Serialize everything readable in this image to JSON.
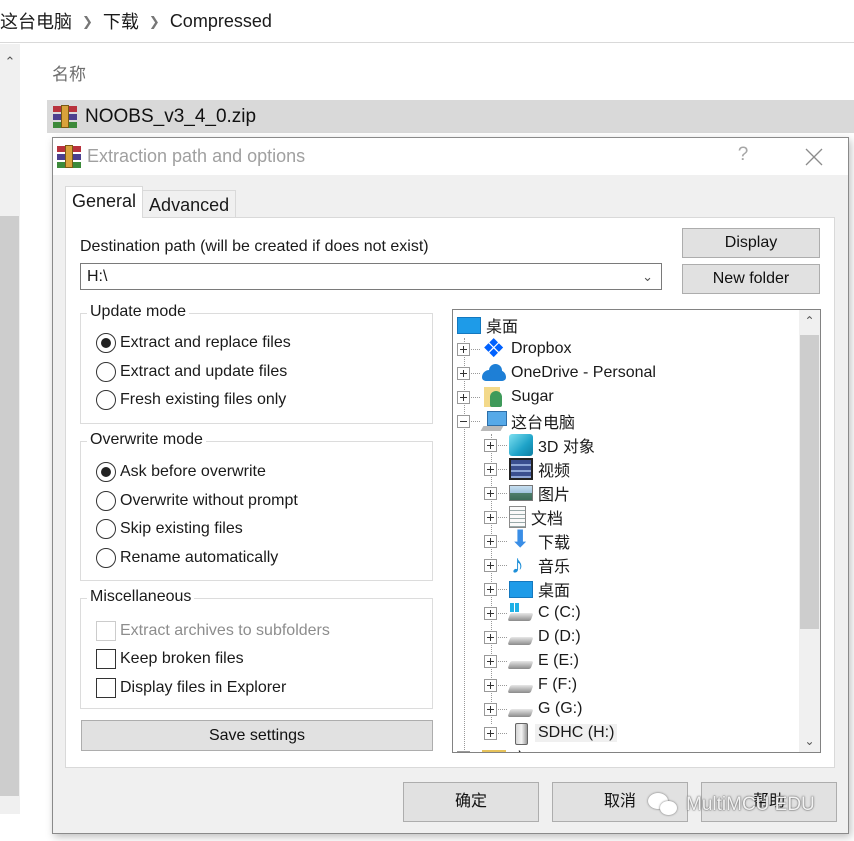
{
  "explorer": {
    "breadcrumb": [
      "这台电脑",
      "下载",
      "Compressed"
    ],
    "column_header": "名称",
    "selected_file": "NOOBS_v3_4_0.zip"
  },
  "dialog": {
    "title": "Extraction path and options",
    "help_glyph": "?",
    "tabs": [
      {
        "label": "General",
        "active": true
      },
      {
        "label": "Advanced",
        "active": false
      }
    ],
    "destination": {
      "label": "Destination path (will be created if does not exist)",
      "value": "H:\\"
    },
    "buttons": {
      "display": "Display",
      "new_folder": "New folder",
      "save_settings": "Save settings",
      "ok": "确定",
      "cancel": "取消",
      "help": "帮助"
    },
    "update_mode": {
      "title": "Update mode",
      "options": [
        {
          "label": "Extract and replace files",
          "selected": true
        },
        {
          "label": "Extract and update files",
          "selected": false
        },
        {
          "label": "Fresh existing files only",
          "selected": false
        }
      ]
    },
    "overwrite_mode": {
      "title": "Overwrite mode",
      "options": [
        {
          "label": "Ask before overwrite",
          "selected": true
        },
        {
          "label": "Overwrite without prompt",
          "selected": false
        },
        {
          "label": "Skip existing files",
          "selected": false
        },
        {
          "label": "Rename automatically",
          "selected": false
        }
      ]
    },
    "miscellaneous": {
      "title": "Miscellaneous",
      "options": [
        {
          "label": "Extract archives to subfolders",
          "checked": false,
          "disabled": true
        },
        {
          "label": "Keep broken files",
          "checked": false,
          "disabled": false
        },
        {
          "label": "Display files in Explorer",
          "checked": false,
          "disabled": false
        }
      ]
    },
    "tree": [
      {
        "label": "桌面",
        "icon": "desktop",
        "level": 0,
        "expander": "none"
      },
      {
        "label": "Dropbox",
        "icon": "dropbox",
        "level": 1,
        "expander": "plus"
      },
      {
        "label": "OneDrive - Personal",
        "icon": "onedrive",
        "level": 1,
        "expander": "plus"
      },
      {
        "label": "Sugar",
        "icon": "user-folder",
        "level": 1,
        "expander": "plus"
      },
      {
        "label": "这台电脑",
        "icon": "this-pc",
        "level": 1,
        "expander": "minus"
      },
      {
        "label": "3D 对象",
        "icon": "3d-objects",
        "level": 2,
        "expander": "plus"
      },
      {
        "label": "视频",
        "icon": "videos",
        "level": 2,
        "expander": "plus"
      },
      {
        "label": "图片",
        "icon": "pictures",
        "level": 2,
        "expander": "plus"
      },
      {
        "label": "文档",
        "icon": "documents",
        "level": 2,
        "expander": "plus"
      },
      {
        "label": "下载",
        "icon": "downloads",
        "level": 2,
        "expander": "plus"
      },
      {
        "label": "音乐",
        "icon": "music",
        "level": 2,
        "expander": "plus"
      },
      {
        "label": "桌面",
        "icon": "desktop",
        "level": 2,
        "expander": "plus"
      },
      {
        "label": "C (C:)",
        "icon": "drive-system",
        "level": 2,
        "expander": "plus"
      },
      {
        "label": "D (D:)",
        "icon": "drive",
        "level": 2,
        "expander": "plus"
      },
      {
        "label": "E (E:)",
        "icon": "drive",
        "level": 2,
        "expander": "plus"
      },
      {
        "label": "F (F:)",
        "icon": "drive",
        "level": 2,
        "expander": "plus"
      },
      {
        "label": "G (G:)",
        "icon": "drive",
        "level": 2,
        "expander": "plus"
      },
      {
        "label": "SDHC (H:)",
        "icon": "sd-card",
        "level": 2,
        "expander": "plus",
        "selected": true
      },
      {
        "label": "库",
        "icon": "folder",
        "level": 1,
        "expander": "plus"
      }
    ]
  },
  "watermark": "MultiMCU EDU"
}
